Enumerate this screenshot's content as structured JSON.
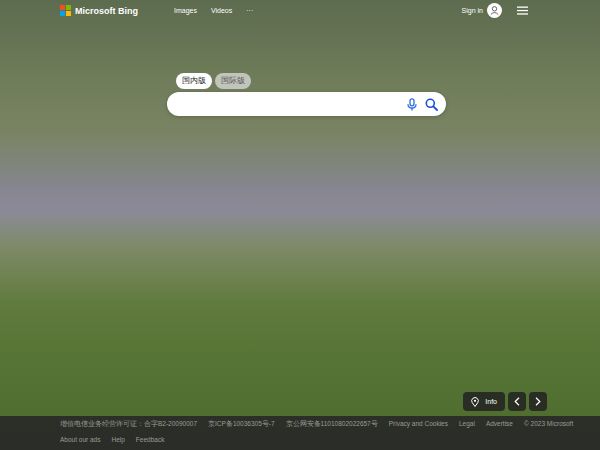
{
  "header": {
    "brand": "Microsoft Bing",
    "nav": [
      {
        "label": "Images"
      },
      {
        "label": "Videos"
      },
      {
        "label": "···"
      }
    ],
    "sign_in": "Sign in"
  },
  "search": {
    "tabs": [
      {
        "label": "国内版",
        "selected": true
      },
      {
        "label": "国际版",
        "selected": false
      }
    ]
  },
  "image_controls": {
    "info": "Info"
  },
  "footer": {
    "rows": [
      [
        "增值电信业务经营许可证：合字B2-20090007",
        "京ICP备10036305号-7",
        "京公网安备11010802022657号",
        "Privacy and Cookies",
        "Legal",
        "Advertise",
        "© 2023 Microsoft"
      ],
      [
        "About our ads",
        "Help",
        "Feedback"
      ]
    ]
  }
}
